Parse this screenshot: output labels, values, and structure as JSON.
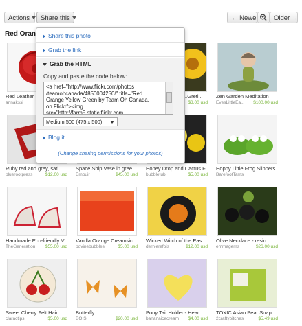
{
  "toolbar": {
    "actions_label": "Actions",
    "share_label": "Share this",
    "newer_label": "← Newer",
    "older_label": "Older →"
  },
  "gallery_title": "Red Orange",
  "share_menu": {
    "share_photo": "Share this photo",
    "grab_link": "Grab the link",
    "grab_html": "Grab the HTML",
    "copy_label": "Copy and paste the code below:",
    "code": "<a href=\"http://www.flickr.com/photos\n/teamohcanada/4850004250/\" title=\"Red\nOrange Yellow Green by Team Oh Canada,\non Flickr\"><img\nsrc=\"http://farm5.static.flickr.com",
    "size_option": "Medium 500 (475 x 500)",
    "blog_it": "Blog it",
    "permissions": "(Change sharing permissions for your photos)"
  },
  "items": [
    {
      "name": "Red Leather F...",
      "shop": "annakssi",
      "price": ""
    },
    {
      "name": "",
      "shop": "",
      "price": ""
    },
    {
      "name": "",
      "shop": "",
      "price": ""
    },
    {
      "name": "...Greti...",
      "shop": "",
      "price": "$3.00 usd"
    },
    {
      "name": "Zen Garden Meditation",
      "shop": "EvesLittleEa...",
      "price": "$100.00 usd"
    },
    {
      "name": "Ruby red and grey, sati...",
      "shop": "bluerootpress",
      "price": "$12.00 usd"
    },
    {
      "name": "Space Ship Vase in gree...",
      "shop": "Embuir",
      "price": "$45.00 usd"
    },
    {
      "name": "Honey Drop and Cactus F...",
      "shop": "bubbletub",
      "price": "$5.00 usd"
    },
    {
      "name": "Hoppy Little Frog Slippers",
      "shop": "BarefootTams",
      "price": "$12.00 usd"
    },
    {
      "name": "Handmade Eco-friendly V...",
      "shop": "TheGeneration",
      "price": "$55.00 usd"
    },
    {
      "name": "Vanilla Orange Creamsic...",
      "shop": "bovinebubbles",
      "price": "$5.00 usd"
    },
    {
      "name": "Wicked Witch of the Eas...",
      "shop": "dernierefois",
      "price": "$12.00 usd"
    },
    {
      "name": "Olive Necklace - resin...",
      "shop": "emmagems",
      "price": "$26.00 usd"
    },
    {
      "name": "Sweet Cherry Felt Hair ...",
      "shop": "claractips",
      "price": "$5.00 usd"
    },
    {
      "name": "Butterfly",
      "shop": "BOIS",
      "price": "$20.00 usd"
    },
    {
      "name": "Pony Tail Holder - Hear...",
      "shop": "bananaicecream",
      "price": "$4.00 usd"
    },
    {
      "name": "TOXIC Asian Pear Soap",
      "shop": "2craftybitches",
      "price": "$5.49 usd"
    }
  ]
}
